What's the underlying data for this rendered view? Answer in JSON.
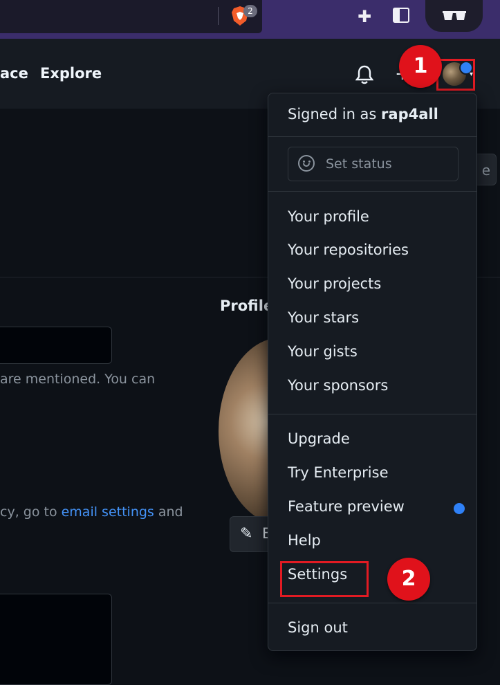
{
  "browser": {
    "shield_count": "2",
    "icons": [
      "brave-lion-icon",
      "puzzle-extensions-icon",
      "sidebar-toggle-icon",
      "private-glasses-icon"
    ]
  },
  "header": {
    "nav_partial": "ace",
    "nav_explore": "Explore",
    "plus_symbol": "+",
    "caret": "▾"
  },
  "annotations": {
    "step1": "1",
    "step2": "2",
    "highlight_color": "#e21b23"
  },
  "page": {
    "save_partial": "e",
    "text_mentioned": "are mentioned. You can",
    "text_privacy_pre": "cy, go to ",
    "text_email_link": "email settings",
    "text_privacy_post": " and",
    "profile_heading": "Profile",
    "edit_partial": "E"
  },
  "menu": {
    "signed_prefix": "Signed in as ",
    "username": "rap4all",
    "set_status": "Set status",
    "items_group1": [
      "Your profile",
      "Your repositories",
      "Your projects",
      "Your stars",
      "Your gists",
      "Your sponsors"
    ],
    "items_group2": [
      "Upgrade",
      "Try Enterprise",
      "Feature preview",
      "Help",
      "Settings"
    ],
    "sign_out": "Sign out"
  },
  "colors": {
    "accent_blue": "#2f81f7",
    "link_blue": "#4493f8",
    "bg": "#0d1117",
    "menu_bg": "#161b22"
  }
}
